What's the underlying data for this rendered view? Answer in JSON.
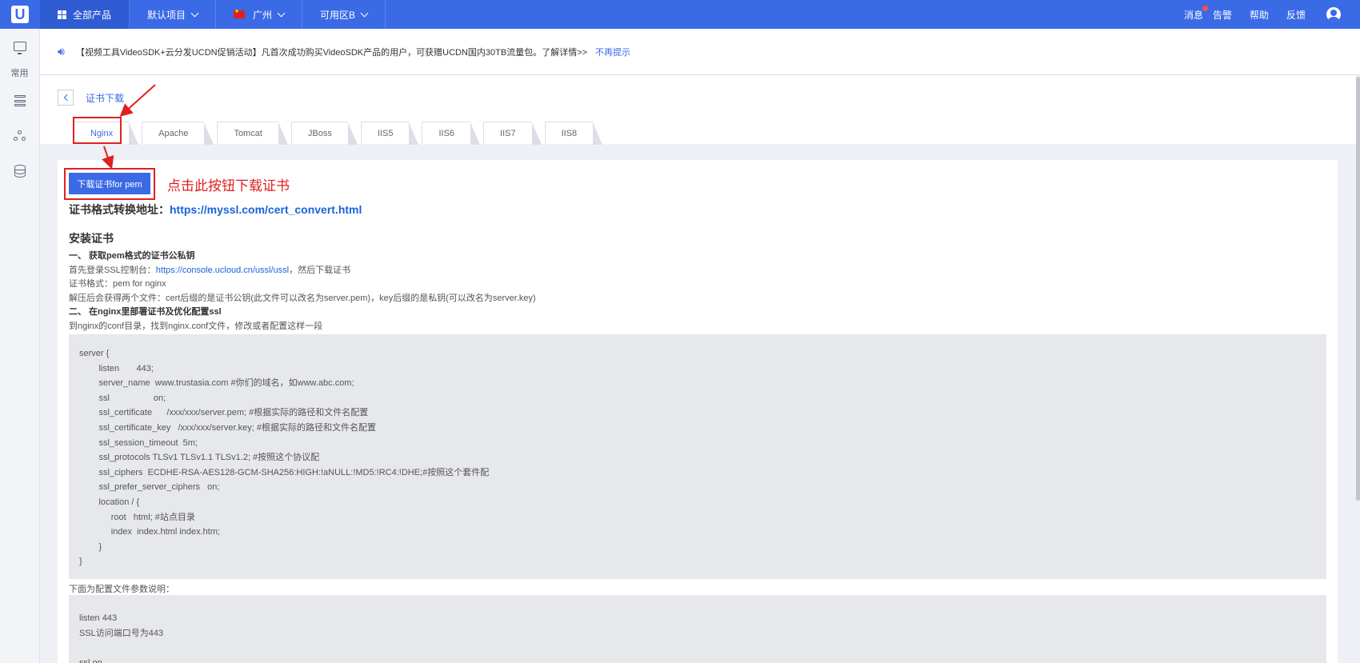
{
  "topbar": {
    "logo": "U",
    "nav": [
      {
        "label": "全部产品",
        "icon": "grid-icon"
      },
      {
        "label": "默认项目",
        "icon": "chevron-down-icon"
      },
      {
        "label": "广州",
        "icon": "flag-icon"
      },
      {
        "label": "可用区B",
        "icon": "chevron-down-icon"
      }
    ],
    "right_links": [
      "消息",
      "告警",
      "帮助",
      "反馈"
    ]
  },
  "sidebar": {
    "section_label": "常用",
    "icons": [
      "monitor-icon",
      "stack-icon",
      "tree-icon",
      "database-icon"
    ]
  },
  "notice": {
    "text": "【视频工具VideoSDK+云分发UCDN促销活动】凡首次成功购买VideoSDK产品的用户，可获赠UCDN国内30TB流量包。了解详情>>",
    "close_label": "不再提示"
  },
  "page": {
    "title": "证书下载",
    "tabs": [
      "Nginx",
      "Apache",
      "Tomcat",
      "JBoss",
      "IIS5",
      "IIS6",
      "IIS7",
      "IIS8"
    ],
    "active_tab": "Nginx"
  },
  "content": {
    "download_button": "下载证书for pem",
    "annotation": "点击此按钮下载证书",
    "convert_label": "证书格式转换地址：",
    "convert_url": "https://myssl.com/cert_convert.html",
    "install_heading": "安装证书",
    "step1_title": "一、 获取pem格式的证书公私钥",
    "step1_line1_prefix": "首先登录SSL控制台：",
    "step1_line1_link": "https://console.ucloud.cn/ussl/ussl",
    "step1_line1_suffix": "，然后下载证书",
    "step1_line2": "证书格式：pem for nginx",
    "step1_line3": "解压后会获得两个文件：cert后缀的是证书公钥(此文件可以改名为server.pem)，key后缀的是私钥(可以改名为server.key)",
    "step2_title": "二、 在nginx里部署证书及优化配置ssl",
    "step2_line1": "到nginx的conf目录，找到nginx.conf文件，修改或者配置这样一段",
    "code_lines": [
      "server {",
      "        listen       443;",
      "        server_name  www.trustasia.com #你们的域名，如www.abc.com;",
      "        ssl                  on;",
      "        ssl_certificate      /xxx/xxx/server.pem; #根据实际的路径和文件名配置",
      "        ssl_certificate_key   /xxx/xxx/server.key; #根据实际的路径和文件名配置",
      "        ssl_session_timeout  5m;",
      "        ssl_protocols TLSv1 TLSv1.1 TLSv1.2; #按照这个协议配",
      "        ssl_ciphers  ECDHE-RSA-AES128-GCM-SHA256:HIGH:!aNULL:!MD5:!RC4:!DHE;#按照这个套件配",
      "        ssl_prefer_server_ciphers   on;",
      "        location / {",
      "             root   html; #站点目录",
      "             index  index.html index.htm;",
      "        }",
      "}"
    ],
    "params_label": "下面为配置文件参数说明：",
    "params_lines": [
      "listen 443",
      "SSL访问端口号为443",
      "",
      "ssl on"
    ]
  },
  "colors": {
    "brand": "#3a6ae6",
    "annotation": "#e02020",
    "link": "#1a63d8"
  }
}
